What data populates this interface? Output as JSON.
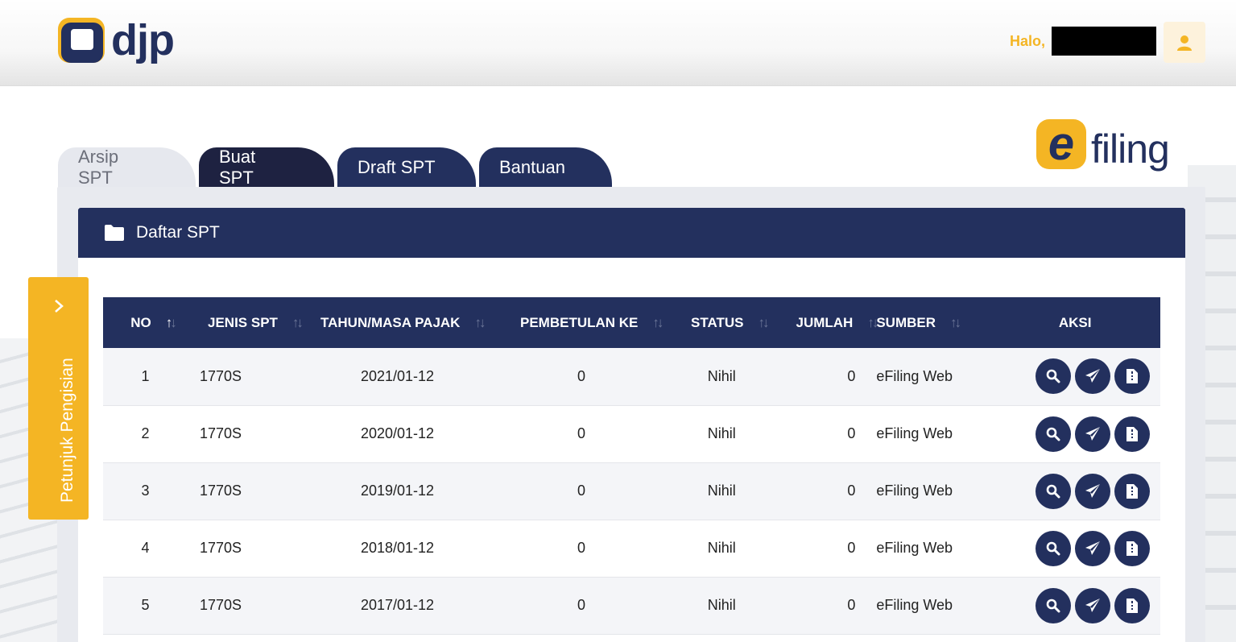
{
  "header": {
    "logo_text": "djp",
    "greeting": "Halo,",
    "user_icon": "user-icon"
  },
  "efiling_logo": {
    "letter": "e",
    "text": "filing"
  },
  "tabs": [
    {
      "label": "Arsip SPT",
      "active": true
    },
    {
      "label": "Buat SPT",
      "active": false
    },
    {
      "label": "Draft SPT",
      "active": false
    },
    {
      "label": "Bantuan",
      "active": false
    }
  ],
  "side_tab": {
    "label": "Petunjuk Pengisian",
    "icon": "chevron-right-icon"
  },
  "card": {
    "title": "Daftar SPT",
    "icon": "folder-icon"
  },
  "table": {
    "columns": [
      "NO",
      "JENIS SPT",
      "TAHUN/MASA PAJAK",
      "PEMBETULAN KE",
      "STATUS",
      "JUMLAH",
      "SUMBER",
      "AKSI"
    ],
    "rows": [
      {
        "no": "1",
        "jenis": "1770S",
        "tahun": "2021/01-12",
        "pembetulan": "0",
        "status": "Nihil",
        "jumlah": "0",
        "sumber": "eFiling Web"
      },
      {
        "no": "2",
        "jenis": "1770S",
        "tahun": "2020/01-12",
        "pembetulan": "0",
        "status": "Nihil",
        "jumlah": "0",
        "sumber": "eFiling Web"
      },
      {
        "no": "3",
        "jenis": "1770S",
        "tahun": "2019/01-12",
        "pembetulan": "0",
        "status": "Nihil",
        "jumlah": "0",
        "sumber": "eFiling Web"
      },
      {
        "no": "4",
        "jenis": "1770S",
        "tahun": "2018/01-12",
        "pembetulan": "0",
        "status": "Nihil",
        "jumlah": "0",
        "sumber": "eFiling Web"
      },
      {
        "no": "5",
        "jenis": "1770S",
        "tahun": "2017/01-12",
        "pembetulan": "0",
        "status": "Nihil",
        "jumlah": "0",
        "sumber": "eFiling Web"
      }
    ],
    "row_actions": [
      "search-icon",
      "send-icon",
      "document-icon"
    ]
  },
  "colors": {
    "navy": "#23305e",
    "dark_tab": "#1e2241",
    "accent": "#f4b524",
    "panel": "#e8eaef"
  }
}
